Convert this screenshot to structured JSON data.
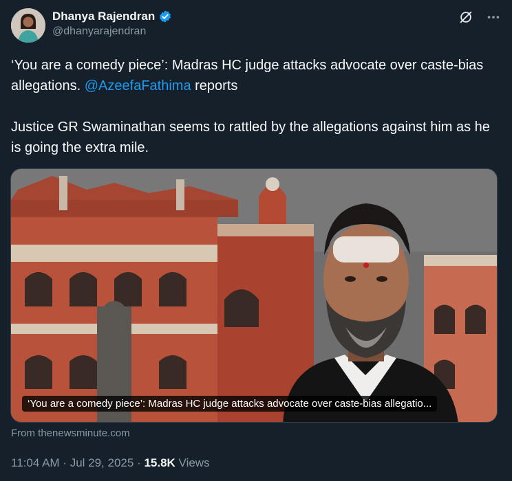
{
  "author": {
    "display_name": "Dhanya Rajendran",
    "handle": "@dhanyarajendran",
    "avatar_icon": "profile-photo",
    "verified_color": "#1d9bf0"
  },
  "actions": {
    "grok_icon": "grok-icon",
    "more_icon": "more-icon"
  },
  "tweet": {
    "line1_before": "‘You are a comedy piece’: Madras HC judge attacks advocate over caste-bias allegations. ",
    "mention": "@AzeefaFathima",
    "line1_after": " reports",
    "paragraph2": "Justice GR Swaminathan seems to rattled by the allegations against him as he is going the extra mile."
  },
  "card": {
    "caption": "‘You are a comedy piece’: Madras HC judge attacks advocate over caste-bias allegatio...",
    "source": "From thenewsminute.com"
  },
  "meta": {
    "time": "11:04 AM",
    "separator1": " · ",
    "date": "Jul 29, 2025",
    "separator2": " · ",
    "views_count": "15.8K",
    "views_label": " Views"
  },
  "colors": {
    "background": "#15202b",
    "link": "#1d9bf0",
    "secondary_text": "#8b98a5"
  }
}
